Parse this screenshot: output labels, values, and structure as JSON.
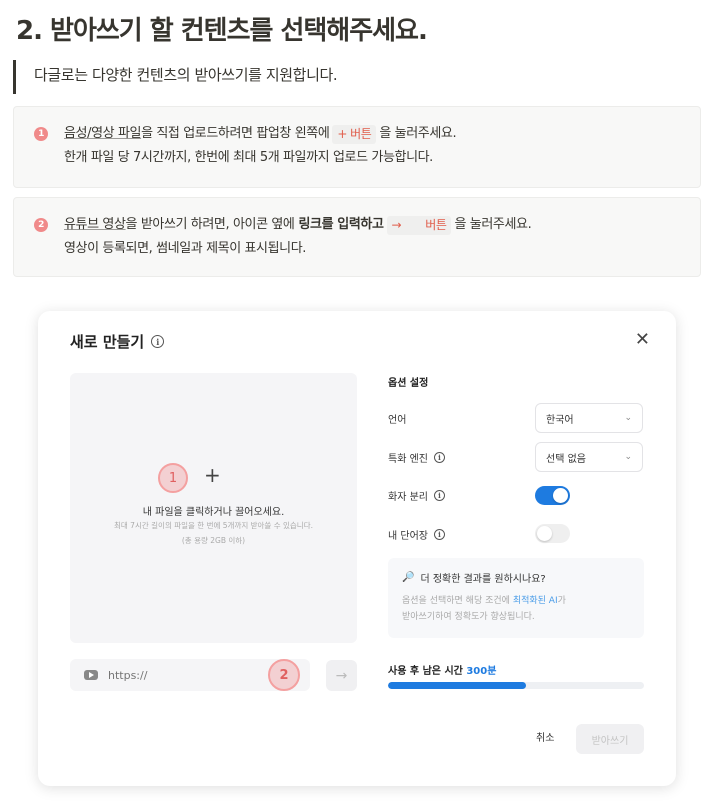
{
  "heading": "2. 받아쓰기 할 컨텐츠를 선택해주세요.",
  "quote": "다글로는 다양한 컨텐츠의 받아쓰기를 지원합니다.",
  "callout1": {
    "num": "1",
    "link": "음성/영상 파일",
    "text_a": "을 직접 업로드하려면 팝업창 왼쪽에",
    "chip_plus": "+",
    "chip_label": "버튼",
    "text_b": "을 눌러주세요.",
    "line2": "한개 파일 당 7시간까지, 한번에 최대 5개 파일까지 업로드 가능합니다."
  },
  "callout2": {
    "num": "2",
    "link": "유튜브 영상",
    "text_a": "을 받아쓰기 하려면, 아이콘 옆에",
    "bold": "링크를 입력하고",
    "chip_arrow": "→",
    "chip_label": "버튼",
    "text_b": "을 눌러주세요.",
    "line2": "영상이 등록되면, 썸네일과 제목이 표시됩니다."
  },
  "modal": {
    "title": "새로 만들기",
    "info_glyph": "i",
    "close_glyph": "✕",
    "dropzone": {
      "marker": "1",
      "plus": "+",
      "main": "내 파일을 클릭하거나 끌어오세요.",
      "sub": "최대 7시간 길이의 파일을 한 번에 5개까지 받아쓸 수 있습니다.",
      "sub2": "(총 용량 2GB 이하)"
    },
    "url": {
      "placeholder": "https://",
      "marker": "2",
      "submit_glyph": "→"
    },
    "options": {
      "title": "옵션 설정",
      "language_label": "언어",
      "language_value": "한국어",
      "engine_label": "특화 엔진",
      "engine_value": "선택 없음",
      "chevron": "⌄",
      "speaker_label": "화자 분리",
      "speaker_on": true,
      "dict_label": "내 단어장",
      "dict_on": false
    },
    "hint": {
      "icon": "🔎",
      "title": "더 정확한 결과를 원하시나요?",
      "body_a": "옵션을 선택하면 해당 조건에",
      "body_link": "최적화된 AI",
      "body_b": "가",
      "body_c": "받아쓰기하여 정확도가 향상됩니다."
    },
    "remaining": {
      "label": "사용 후 남은 시간",
      "value": "300분",
      "fill_fraction": 0.54
    },
    "cancel": "취소",
    "submit": "받아쓰기"
  }
}
